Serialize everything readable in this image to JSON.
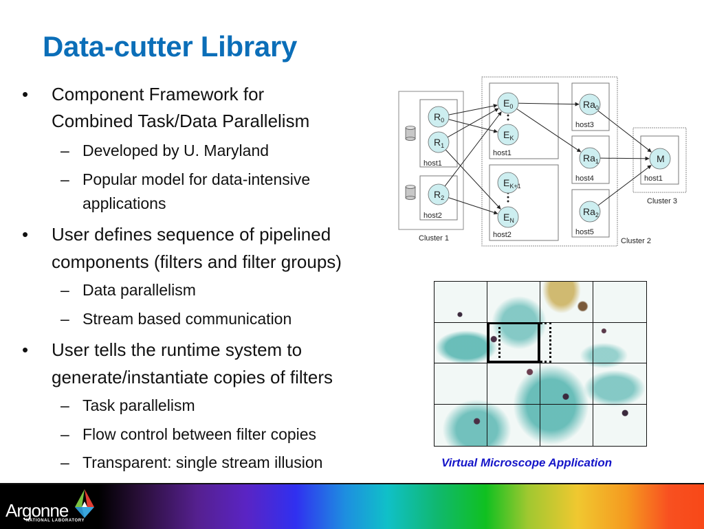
{
  "slide": {
    "title": "Data-cutter Library",
    "bullets": [
      {
        "lines": [
          "Component Framework for",
          "Combined Task/Data Parallelism"
        ],
        "sub": [
          {
            "lines": [
              "Developed by U. Maryland"
            ]
          },
          {
            "lines": [
              "Popular model for data-intensive",
              "applications"
            ]
          }
        ]
      },
      {
        "lines": [
          "User defines sequence of pipelined",
          "components (filters and filter groups)"
        ],
        "sub": [
          {
            "lines": [
              "Data parallelism"
            ]
          },
          {
            "lines": [
              "Stream based communication"
            ]
          }
        ]
      },
      {
        "lines": [
          "User tells the runtime system to",
          "generate/instantiate copies of filters"
        ],
        "sub": [
          {
            "lines": [
              "Task parallelism"
            ]
          },
          {
            "lines": [
              "Flow control between filter copies"
            ]
          },
          {
            "lines": [
              "Transparent: single stream illusion"
            ]
          }
        ]
      }
    ],
    "bullet_glyph": "•",
    "sub_bullet_glyph": "–",
    "colors": {
      "title": "#0b6eb8",
      "caption": "#1515c8",
      "node_fill": "#cdeef0"
    }
  },
  "diagram": {
    "clusters": [
      {
        "id": "cluster1",
        "label": "Cluster 1"
      },
      {
        "id": "cluster2",
        "label": "Cluster 2"
      },
      {
        "id": "cluster3",
        "label": "Cluster 3"
      }
    ],
    "hosts": {
      "c1_host1": "host1",
      "c1_host2": "host2",
      "c2_host1": "host1",
      "c2_host2": "host2",
      "c2_host3": "host3",
      "c2_host4": "host4",
      "c2_host5": "host5",
      "c3_host1": "host1"
    },
    "nodes": {
      "R0": {
        "base": "R",
        "sub": "0"
      },
      "R1": {
        "base": "R",
        "sub": "1"
      },
      "R2": {
        "base": "R",
        "sub": "2"
      },
      "E0": {
        "base": "E",
        "sub": "0"
      },
      "EK": {
        "base": "E",
        "sub": "K"
      },
      "EK1": {
        "base": "E",
        "sub": "K+1"
      },
      "EN": {
        "base": "E",
        "sub": "N"
      },
      "Ra0": {
        "base": "Ra",
        "sub": "0"
      },
      "Ra1": {
        "base": "Ra",
        "sub": "1"
      },
      "Ra2": {
        "base": "Ra",
        "sub": "2"
      },
      "M": {
        "base": "M",
        "sub": ""
      }
    },
    "edges": [
      [
        "R0",
        "E0"
      ],
      [
        "R0",
        "EK"
      ],
      [
        "R1",
        "E0"
      ],
      [
        "R1",
        "EN"
      ],
      [
        "R2",
        "E0"
      ],
      [
        "R2",
        "EN"
      ],
      [
        "E0",
        "Ra0"
      ],
      [
        "E0",
        "Ra1"
      ],
      [
        "Ra0",
        "M"
      ],
      [
        "Ra1",
        "M"
      ],
      [
        "Ra2",
        "M"
      ]
    ]
  },
  "figure": {
    "caption": "Virtual Microscope Application",
    "grid_rows": 4,
    "grid_cols": 4
  },
  "footer": {
    "logo_text": "Argonne",
    "logo_subtext": "NATIONAL LABORATORY"
  }
}
